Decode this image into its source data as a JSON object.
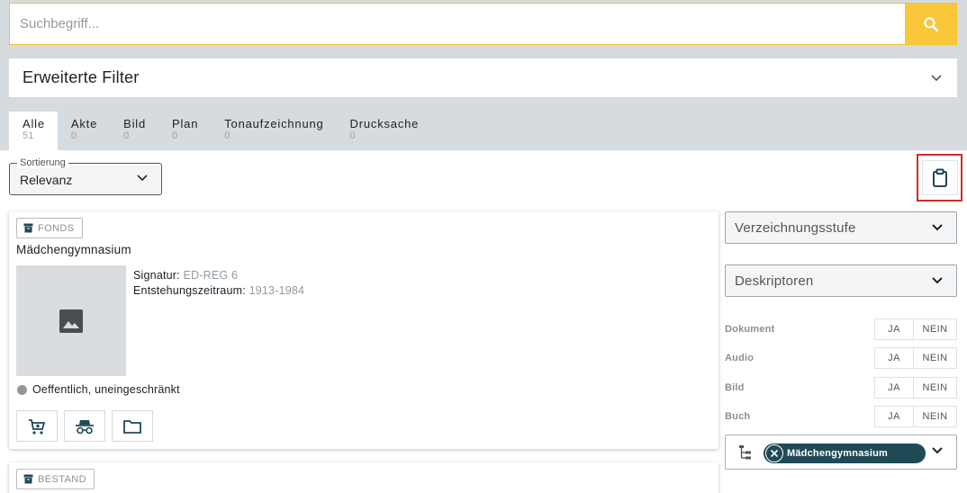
{
  "search": {
    "placeholder": "Suchbegriff...",
    "value": ""
  },
  "advanced_filter": {
    "title": "Erweiterte Filter"
  },
  "tabs": [
    {
      "label": "Alle",
      "count": "51"
    },
    {
      "label": "Akte",
      "count": "0"
    },
    {
      "label": "Bild",
      "count": "0"
    },
    {
      "label": "Plan",
      "count": "0"
    },
    {
      "label": "Tonaufzeichnung",
      "count": "0"
    },
    {
      "label": "Drucksache",
      "count": "0"
    }
  ],
  "sort": {
    "legend": "Sortierung",
    "value": "Relevanz"
  },
  "results": [
    {
      "type_badge": "FONDS",
      "title": "Mädchengymnasium",
      "signature_label": "Signatur:",
      "signature_value": "ED-REG 6",
      "period_label": "Entstehungszeitraum:",
      "period_value": "1913-1984",
      "access_text": "Oeffentlich, uneingeschränkt",
      "access_color": "#979797"
    },
    {
      "type_badge": "BESTAND"
    }
  ],
  "filters": {
    "level_dropdown": "Verzeichnungsstufe",
    "descriptor_dropdown": "Deskriptoren",
    "toggles": [
      {
        "label": "Dokument",
        "yes": "JA",
        "no": "NEIN"
      },
      {
        "label": "Audio",
        "yes": "JA",
        "no": "NEIN"
      },
      {
        "label": "Bild",
        "yes": "JA",
        "no": "NEIN"
      },
      {
        "label": "Buch",
        "yes": "JA",
        "no": "NEIN"
      }
    ],
    "tree_chip": "Mädchengymnasium"
  },
  "colors": {
    "accent": "#f9c73a",
    "chip": "#1f4a55",
    "icon": "#1f4a55",
    "highlight_border": "#d62a2a",
    "tab_bar": "#d5dbdf"
  }
}
